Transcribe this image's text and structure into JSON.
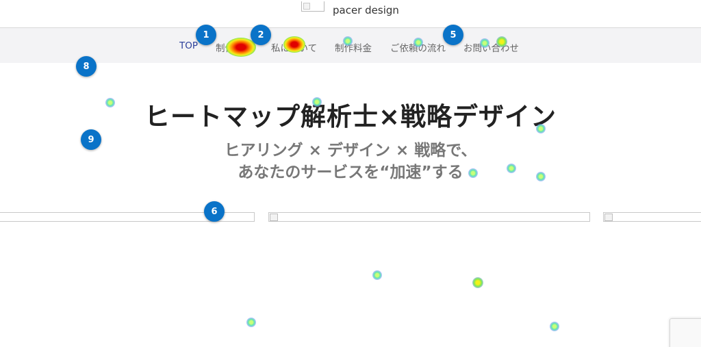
{
  "header": {
    "site_name": "pacer design"
  },
  "nav": {
    "items": [
      {
        "label": "TOP",
        "active": true
      },
      {
        "label": "制作実績",
        "active": false
      },
      {
        "label": "私について",
        "active": false
      },
      {
        "label": "制作料金",
        "active": false
      },
      {
        "label": "ご依頼の流れ",
        "active": false
      },
      {
        "label": "お問い合わせ",
        "active": false
      }
    ]
  },
  "hero": {
    "title": "ヒートマップ解析士×戦略デザイン",
    "subtitle_line1": "ヒアリング × デザイン × 戦略で、",
    "subtitle_line2": "あなたのサービスを“加速”する"
  },
  "markers": [
    "1",
    "2",
    "5",
    "8",
    "9",
    "6"
  ],
  "colors": {
    "marker": "#0a73c8",
    "nav_active": "#2b3f9a",
    "nav_bg": "#f3f3f5",
    "title": "#222222",
    "subtitle": "#777777"
  }
}
